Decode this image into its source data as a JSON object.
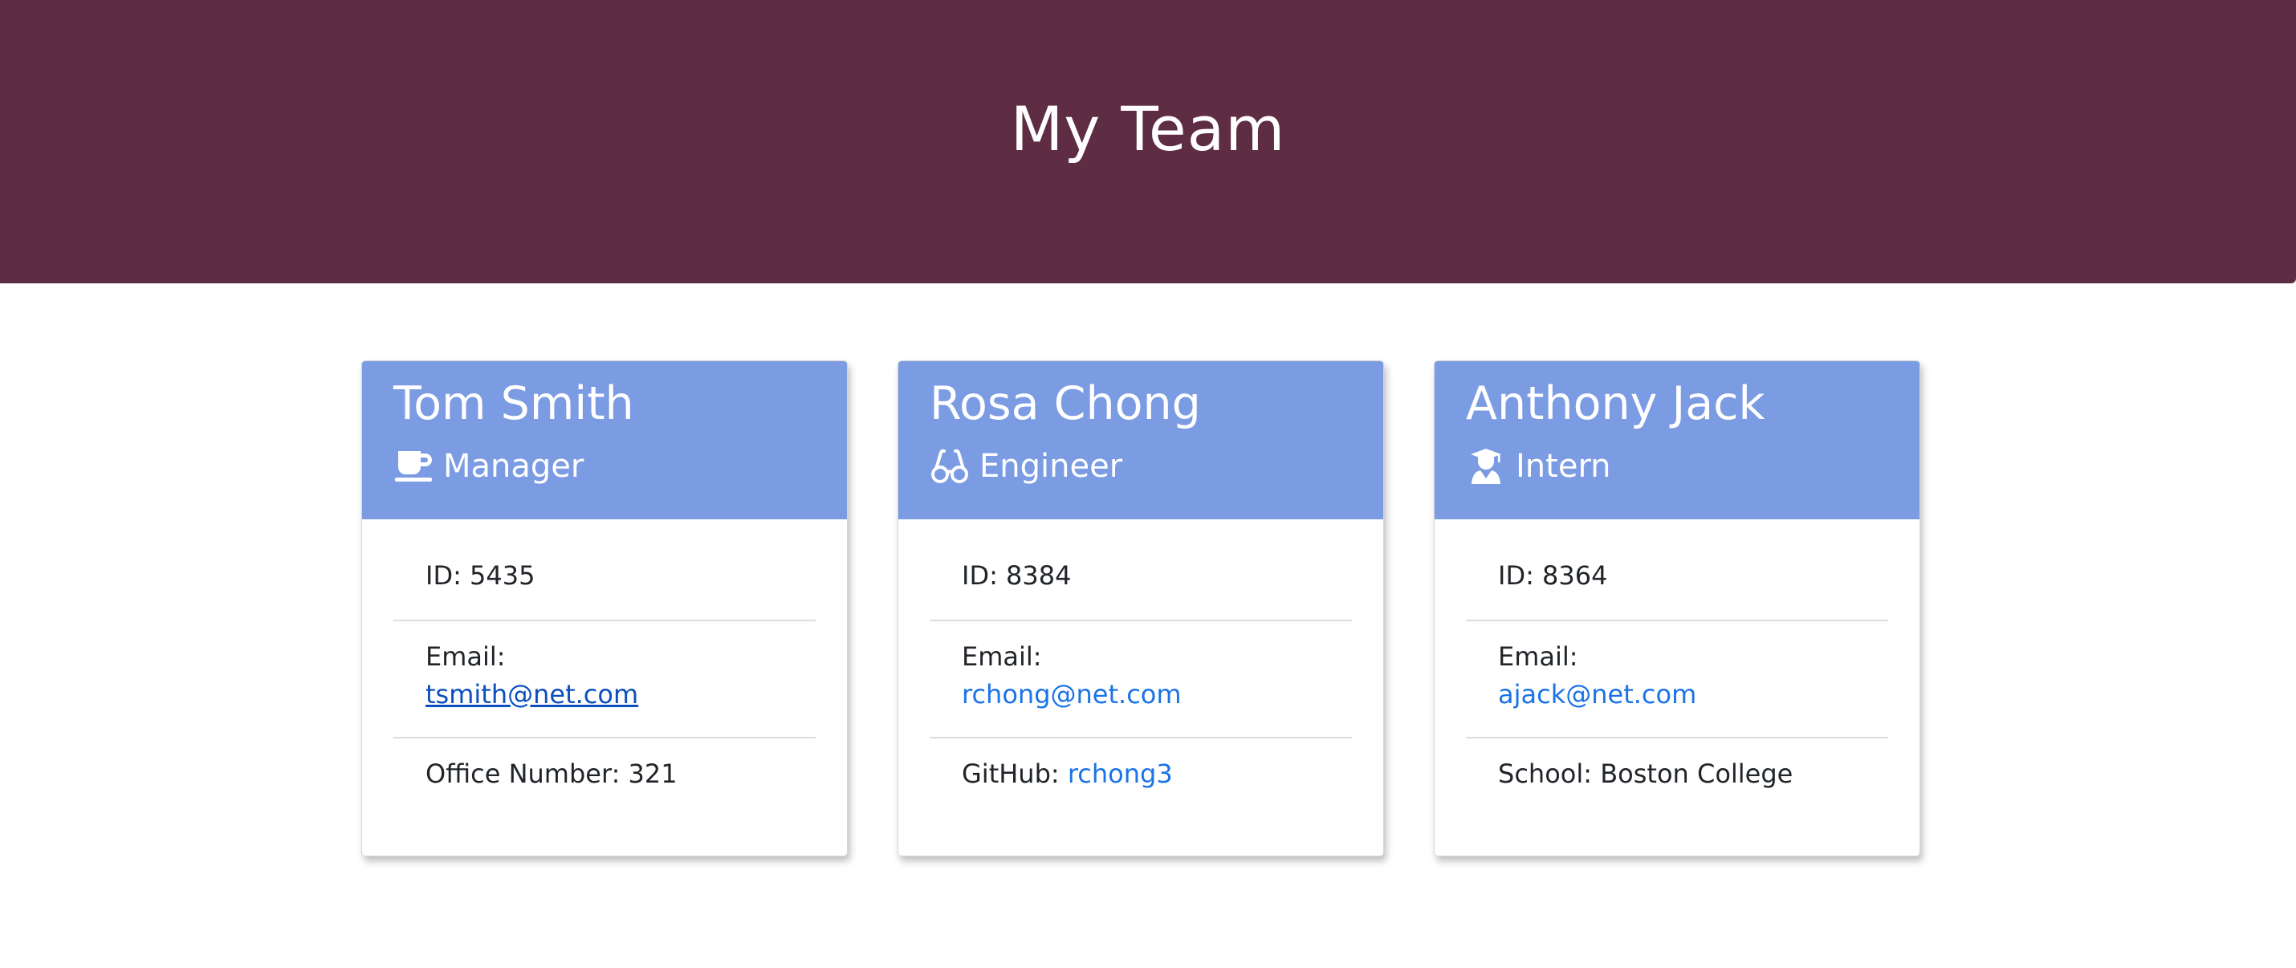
{
  "header": {
    "title": "My Team"
  },
  "cards": [
    {
      "name": "Tom Smith",
      "role": "Manager",
      "icon": "coffee-cup-icon",
      "id_label": "ID:",
      "id": "5435",
      "email_label": "Email:",
      "email": "tsmith@net.com",
      "extra_label": "Office Number:",
      "extra_value": "321"
    },
    {
      "name": "Rosa Chong",
      "role": "Engineer",
      "icon": "glasses-icon",
      "id_label": "ID:",
      "id": "8384",
      "email_label": "Email:",
      "email": "rchong@net.com",
      "extra_label": "GitHub:",
      "extra_value": "rchong3"
    },
    {
      "name": "Anthony Jack",
      "role": "Intern",
      "icon": "graduate-icon",
      "id_label": "ID:",
      "id": "8364",
      "email_label": "Email:",
      "email": "ajack@net.com",
      "extra_label": "School:",
      "extra_value": "Boston College"
    }
  ],
  "colors": {
    "header_bg": "#5e2c43",
    "card_header_bg": "#7b9be3",
    "link": "#1a73e8",
    "visited_link": "#0b4fc0"
  }
}
